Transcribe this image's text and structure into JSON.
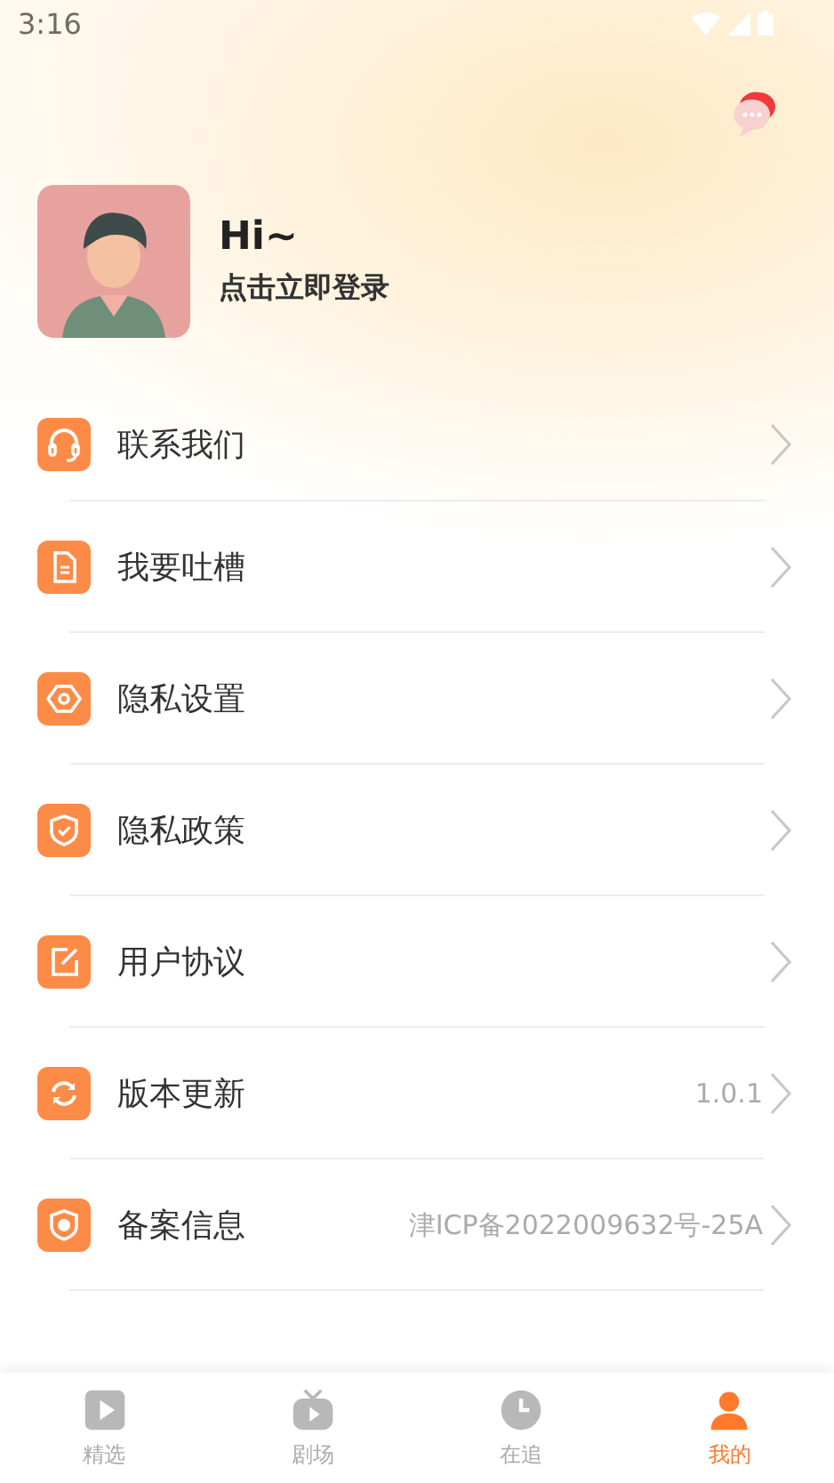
{
  "status_bar": {
    "time": "3:16"
  },
  "profile": {
    "greeting": "Hi~",
    "login_prompt": "点击立即登录"
  },
  "menu": [
    {
      "label": "联系我们"
    },
    {
      "label": "我要吐槽"
    },
    {
      "label": "隐私设置"
    },
    {
      "label": "隐私政策"
    },
    {
      "label": "用户协议"
    },
    {
      "label": "版本更新",
      "value": "1.0.1"
    },
    {
      "label": "备案信息",
      "value": "津ICP备2022009632号-25A"
    }
  ],
  "tabs": [
    {
      "label": "精选",
      "selected": false
    },
    {
      "label": "剧场",
      "selected": false
    },
    {
      "label": "在追",
      "selected": false
    },
    {
      "label": "我的",
      "selected": true
    }
  ]
}
